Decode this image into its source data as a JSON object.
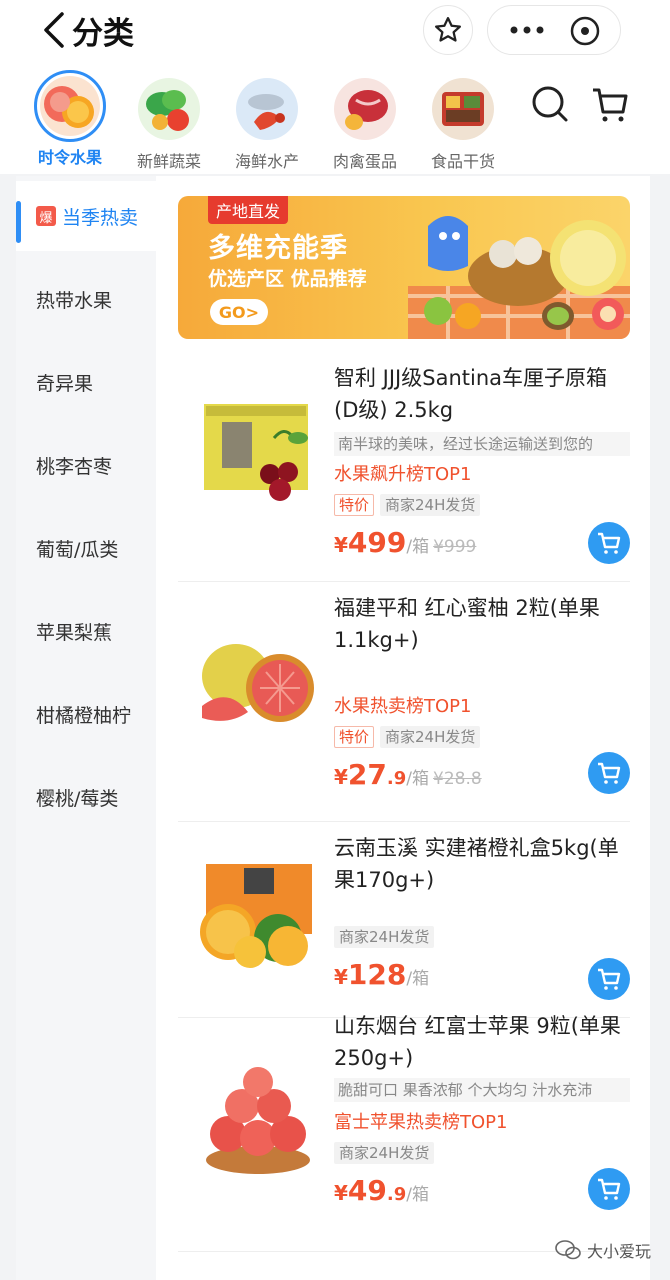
{
  "header": {
    "title": "分类"
  },
  "categories": [
    {
      "label": "时令水果",
      "active": true
    },
    {
      "label": "新鲜蔬菜",
      "active": false
    },
    {
      "label": "海鲜水产",
      "active": false
    },
    {
      "label": "肉禽蛋品",
      "active": false
    },
    {
      "label": "食品干货",
      "active": false
    }
  ],
  "side_nav": {
    "hot_badge": "爆",
    "items": [
      {
        "label": "当季热卖"
      },
      {
        "label": "热带水果"
      },
      {
        "label": "奇异果"
      },
      {
        "label": "桃李杏枣"
      },
      {
        "label": "葡萄/瓜类"
      },
      {
        "label": "苹果梨蕉"
      },
      {
        "label": "柑橘橙柚柠"
      },
      {
        "label": "樱桃/莓类"
      }
    ]
  },
  "banner": {
    "tag": "产地直发",
    "title": "多维充能季",
    "subtitle": "优选产区 优品推荐",
    "go_label": "GO>"
  },
  "products": [
    {
      "name": "智利 JJJ级Santina车厘子原箱(D级) 2.5kg",
      "desc": "南半球的美味，经过长途运输送到您的",
      "rank": "水果飙升榜TOP1",
      "tag_sale": "特价",
      "tag_ship": "商家24H发货",
      "currency": "¥",
      "price_int": "499",
      "price_dec": "",
      "unit": "/箱",
      "orig_price": "¥999"
    },
    {
      "name": "福建平和 红心蜜柚 2粒(单果1.1kg+)",
      "desc": "",
      "rank": "水果热卖榜TOP1",
      "tag_sale": "特价",
      "tag_ship": "商家24H发货",
      "currency": "¥",
      "price_int": "27",
      "price_dec": ".9",
      "unit": "/箱",
      "orig_price": "¥28.8"
    },
    {
      "name": "云南玉溪 实建褚橙礼盒5kg(单果170g+)",
      "desc": "",
      "rank": "",
      "tag_sale": "",
      "tag_ship": "商家24H发货",
      "currency": "¥",
      "price_int": "128",
      "price_dec": "",
      "unit": "/箱",
      "orig_price": ""
    },
    {
      "name": "山东烟台 红富士苹果 9粒(单果250g+)",
      "desc": "脆甜可口 果香浓郁 个大均匀 汁水充沛",
      "rank": "富士苹果热卖榜TOP1",
      "tag_sale": "",
      "tag_ship": "商家24H发货",
      "currency": "¥",
      "price_int": "49",
      "price_dec": ".9",
      "unit": "/箱",
      "orig_price": ""
    }
  ],
  "watermark": "大小爱玩",
  "colors": {
    "accent": "#2f8ef5",
    "price": "#f0522e",
    "cart": "#2f9bf2"
  }
}
